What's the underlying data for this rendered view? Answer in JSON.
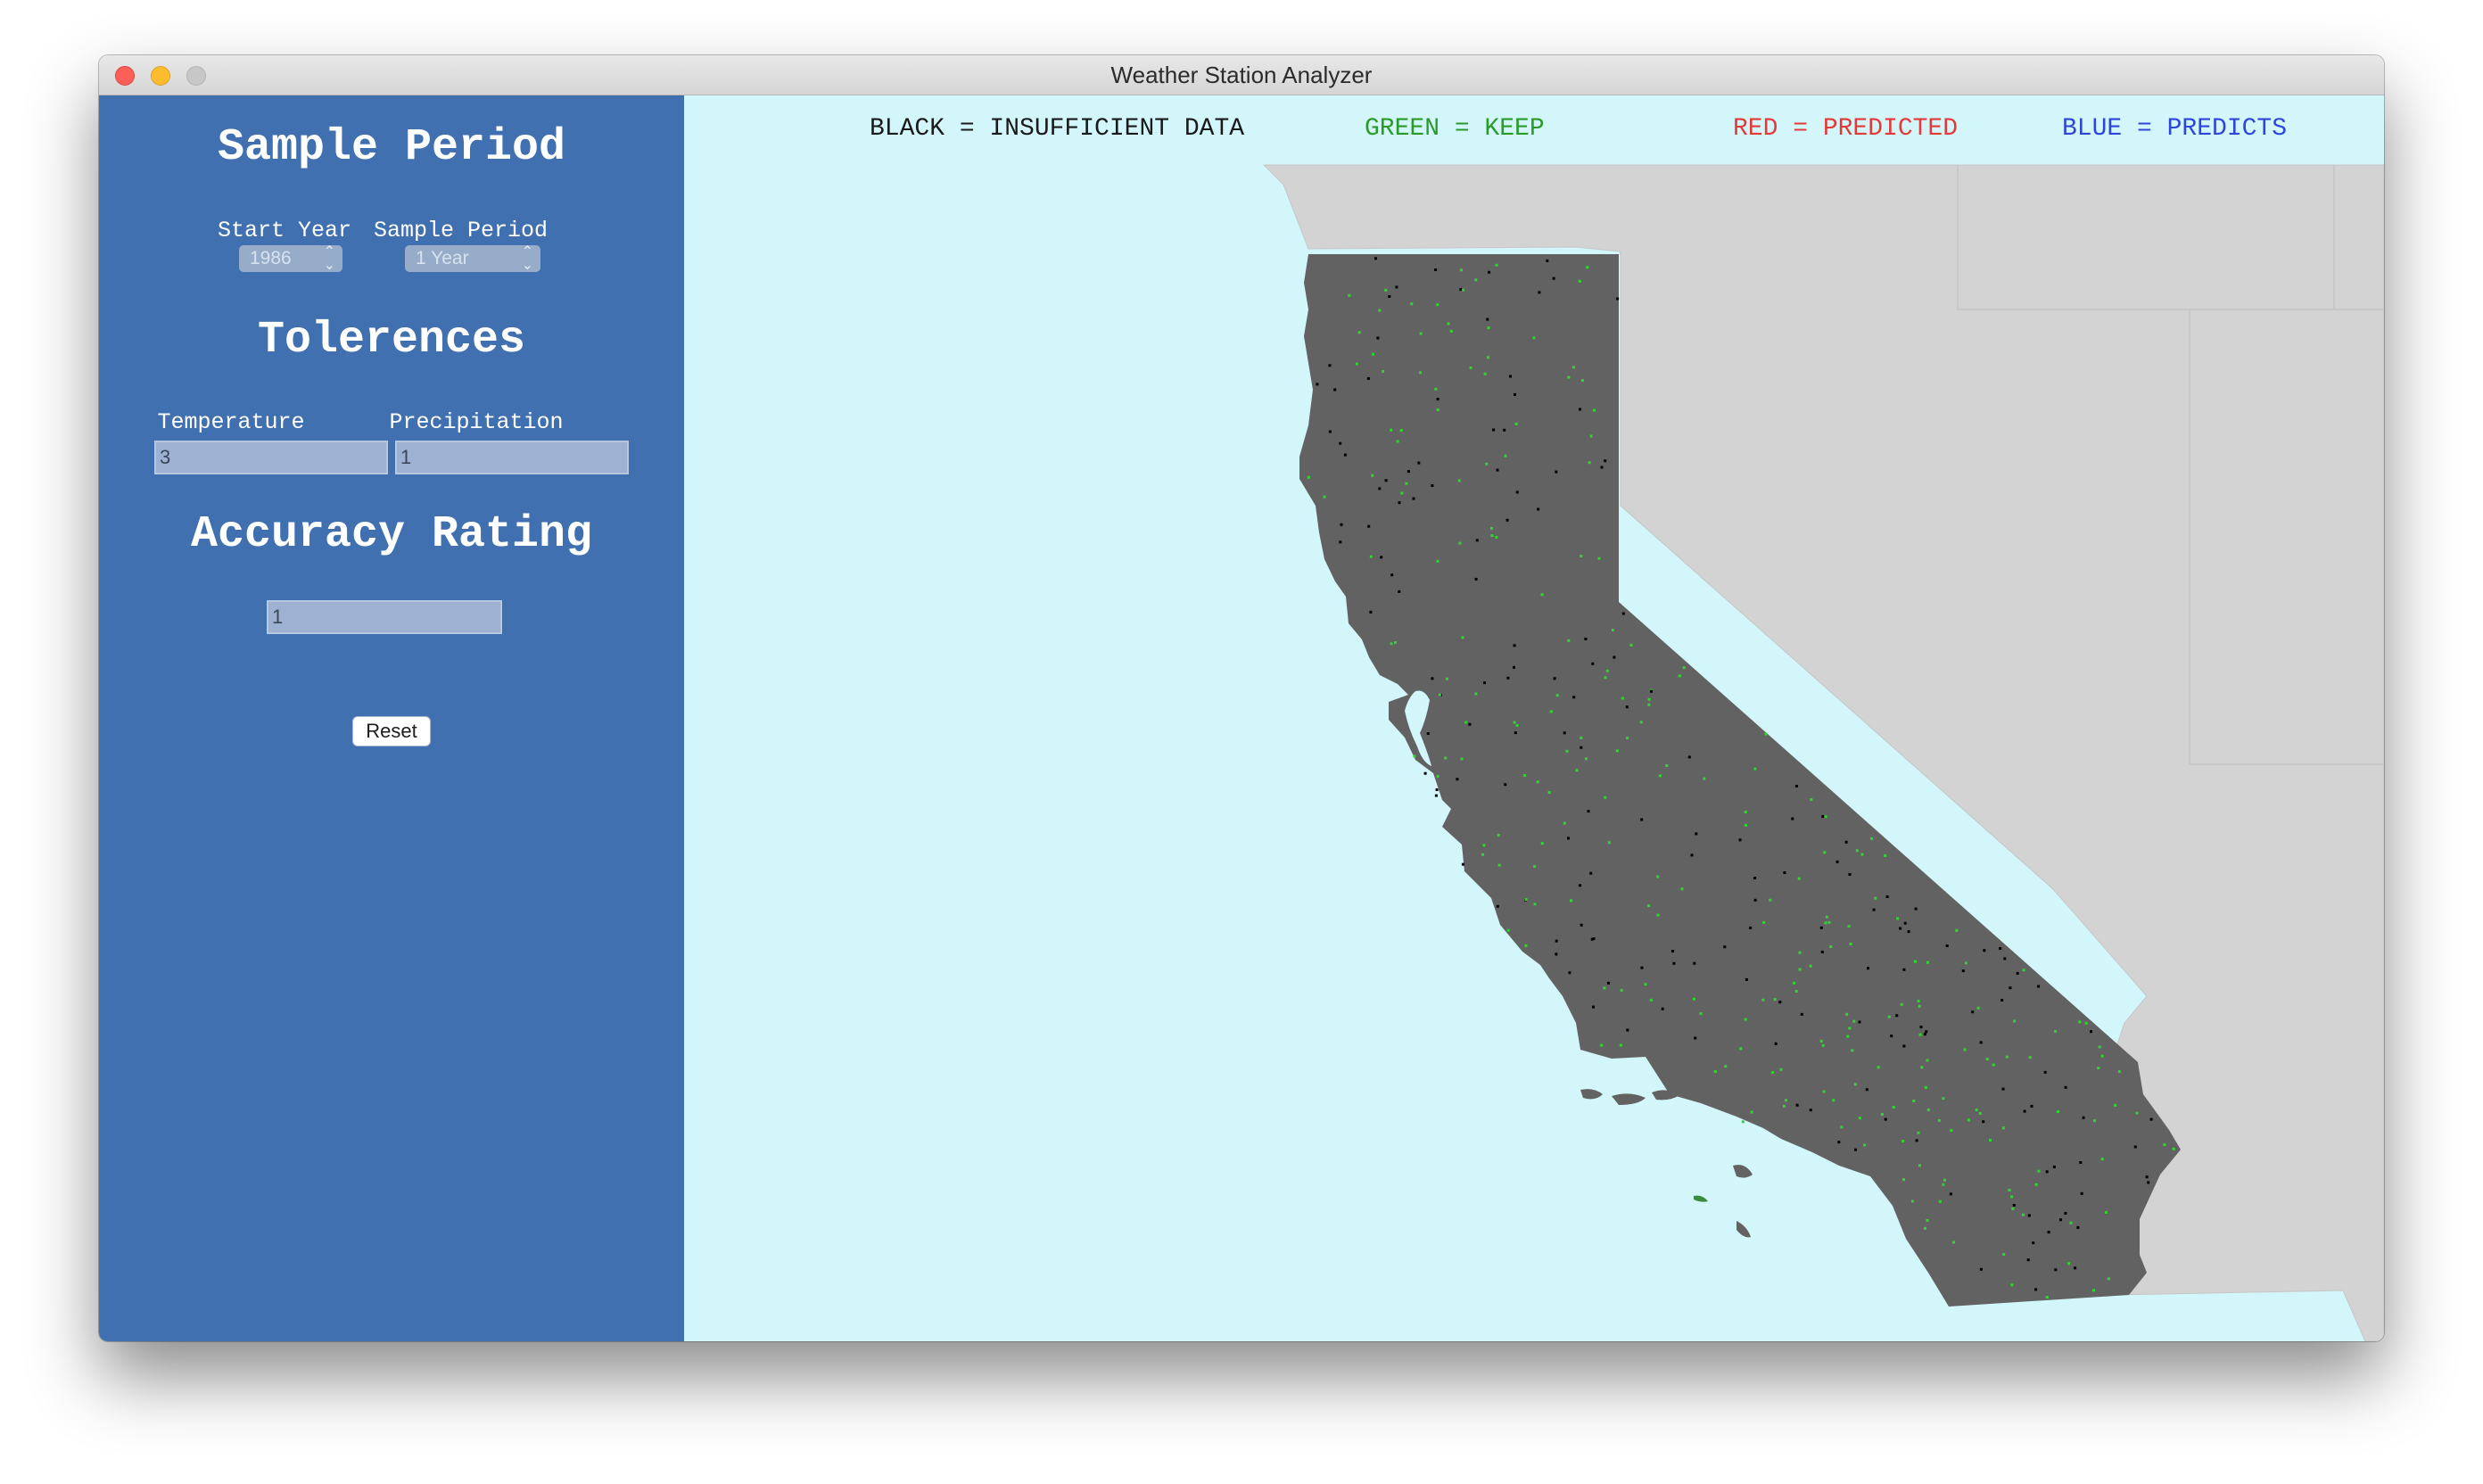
{
  "window": {
    "title": "Weather Station Analyzer"
  },
  "sidebar": {
    "sample_period": {
      "heading": "Sample Period",
      "start_year_label": "Start Year",
      "start_year_value": "1986",
      "period_label": "Sample Period",
      "period_value": "1 Year"
    },
    "tolerences": {
      "heading": "Tolerences",
      "temperature_label": "Temperature",
      "temperature_value": "3",
      "precipitation_label": "Precipitation",
      "precipitation_value": "1"
    },
    "accuracy": {
      "heading": "Accuracy Rating",
      "value": "1",
      "reset_label": "Reset"
    }
  },
  "legend": {
    "black": "BLACK = INSUFFICIENT DATA",
    "green": "GREEN = KEEP",
    "red": "RED = PREDICTED",
    "blue": "BLUE = PREDICTS"
  },
  "colors": {
    "sidebar_bg": "#4070af",
    "ocean": "#d3f6fb",
    "california": "#626262",
    "neighbor_land": "#d3d3d3",
    "legend_black": "#1a1a1a",
    "legend_green": "#2a9a2a",
    "legend_red": "#e23a3a",
    "legend_blue": "#2e46d8",
    "station_insufficient": "#000000",
    "station_keep": "#2fd62f"
  }
}
